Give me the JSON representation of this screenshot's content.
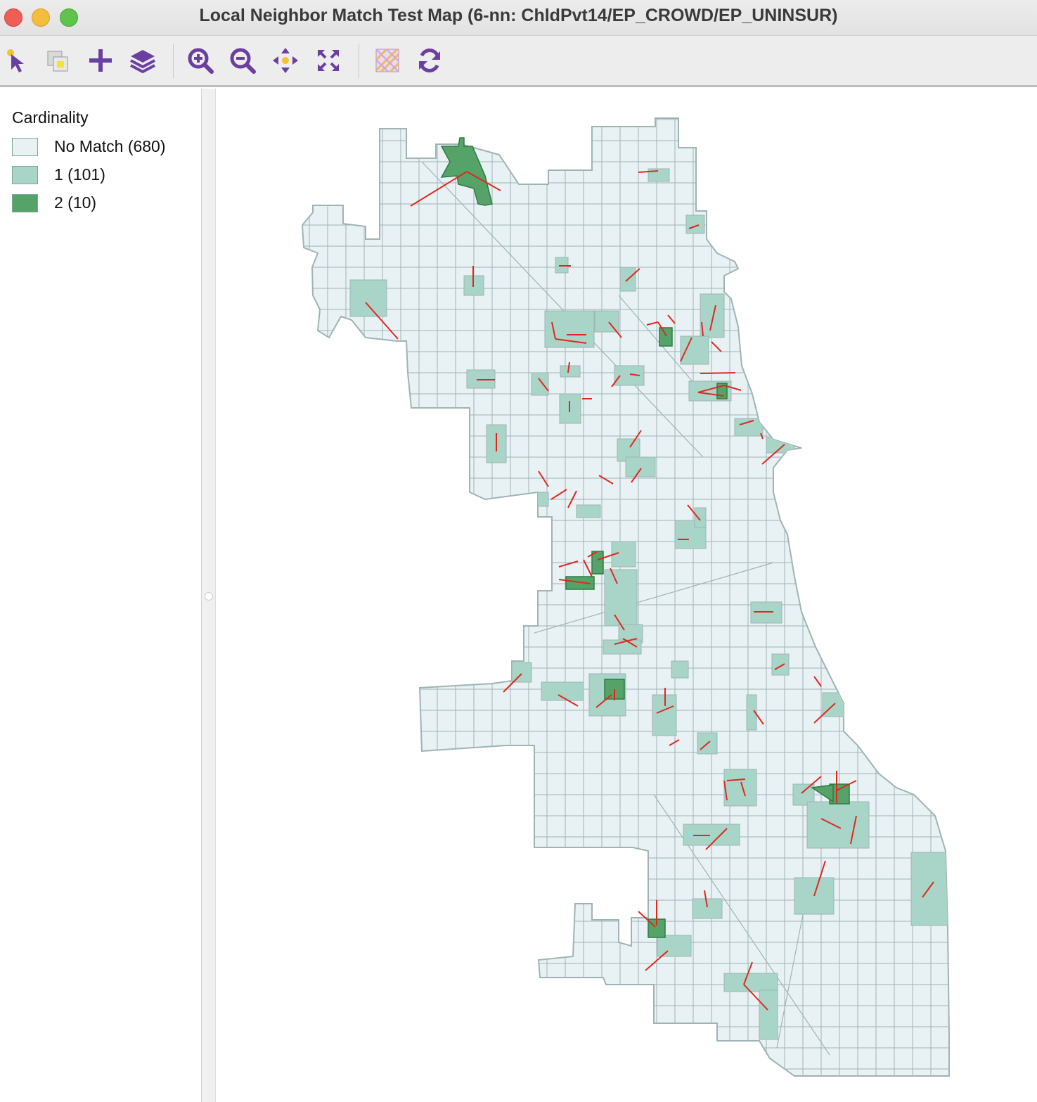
{
  "window": {
    "title": "Local Neighbor Match Test Map (6-nn: ChldPvt14/EP_CROWD/EP_UNINSUR)"
  },
  "toolbar": {
    "tools": [
      {
        "name": "select-icon"
      },
      {
        "name": "selection-layers-icon"
      },
      {
        "name": "add-icon"
      },
      {
        "name": "layers-icon"
      },
      {
        "name": "zoom-in-icon"
      },
      {
        "name": "zoom-out-icon"
      },
      {
        "name": "pan-icon"
      },
      {
        "name": "full-extent-icon"
      },
      {
        "name": "basemap-icon"
      },
      {
        "name": "refresh-icon"
      }
    ]
  },
  "legend": {
    "title": "Cardinality",
    "items": [
      {
        "label": "No Match (680)",
        "color": "#e8f2f5"
      },
      {
        "label": "1 (101)",
        "color": "#a8d5c7"
      },
      {
        "label": "2 (10)",
        "color": "#55a368"
      }
    ]
  },
  "colors": {
    "boundary": "#9fb3b5",
    "link": "#e0281f",
    "accent": "#6b3fa0"
  }
}
